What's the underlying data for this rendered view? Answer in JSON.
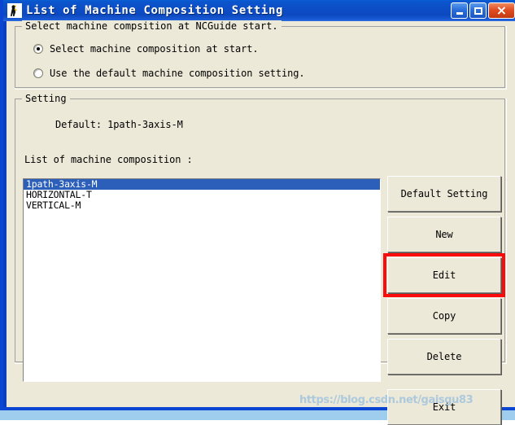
{
  "window": {
    "title": "List of Machine Composition Setting",
    "icon": "app-person-icon",
    "caption": {
      "minimize": "minimize-icon",
      "maximize": "maximize-icon",
      "close": "×"
    }
  },
  "start_group": {
    "title": "Select machine compsition at NCGuide start.",
    "options": [
      {
        "label": "Select machine composition at start.",
        "checked": true
      },
      {
        "label": "Use the default machine composition setting.",
        "checked": false
      }
    ]
  },
  "setting_group": {
    "title": "Setting",
    "default_line": "Default: 1path-3axis-M",
    "list_caption": "List of machine composition :",
    "list_items": [
      {
        "label": "1path-3axis-M",
        "selected": true
      },
      {
        "label": "HORIZONTAL-T",
        "selected": false
      },
      {
        "label": "VERTICAL-M",
        "selected": false
      }
    ]
  },
  "buttons": {
    "default_setting": "Default Setting",
    "new": "New",
    "edit": "Edit",
    "copy": "Copy",
    "delete": "Delete",
    "exit": "Exit"
  },
  "annotation": {
    "target": "Edit",
    "color": "#fb0b0b"
  },
  "watermark": "https://blog.csdn.net/gaisgu83",
  "colors": {
    "titlebar_blue": "#0c49c0",
    "window_border": "#0a46d2",
    "client_bg": "#ece9d8",
    "selection_blue": "#2b5fba",
    "desktop_blue": "#a8d4f0"
  }
}
